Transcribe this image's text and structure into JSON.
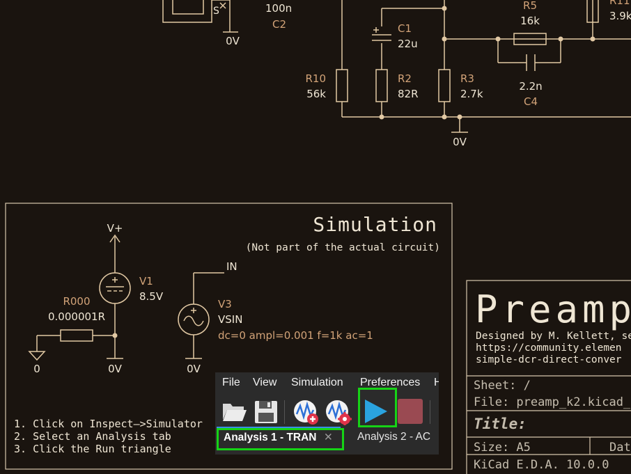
{
  "schematic": {
    "top_parts": {
      "c2": {
        "value": "100n",
        "ref": "C2"
      },
      "c1": {
        "ref": "C1",
        "value": "22u"
      },
      "r5": {
        "ref": "R5",
        "value": "16k"
      },
      "r10": {
        "ref": "R10",
        "value": "56k"
      },
      "r2": {
        "ref": "R2",
        "value": "82R"
      },
      "r3": {
        "ref": "R3",
        "value": "2.7k"
      },
      "c4": {
        "value": "2.2n",
        "ref": "C4"
      },
      "r11": {
        "ref": "R11",
        "value": "3.9k"
      },
      "gnd_labels": [
        "0V",
        "0V"
      ],
      "switch_pin": "S"
    },
    "simulation_box": {
      "title": "Simulation",
      "subtitle": "(Not part of the actual circuit)",
      "v1": {
        "ref": "V1",
        "value": "8.5V",
        "net": "V+"
      },
      "r000": {
        "ref": "R000",
        "value": "0.000001R"
      },
      "v3": {
        "ref": "V3",
        "value": "VSIN",
        "params": "dc=0 ampl=0.001 f=1k ac=1",
        "net": "IN"
      },
      "gnd_labels": [
        "0",
        "0V",
        "0V"
      ],
      "instructions": [
        "1. Click on Inspect—>Simulator",
        "2. Select an Analysis tab",
        "3. Click the Run triangle"
      ]
    },
    "title_block": {
      "big_title": "Preamp",
      "designer": "Designed by M. Kellett, se",
      "url1": "https://community.elemen",
      "url2": "simple-dcr-direct-conver",
      "sheet": "Sheet: /",
      "file": "File: preamp_k2.kicad_",
      "title_label": "Title:",
      "size": "Size: A5",
      "date": "Dat",
      "version": "KiCad E.D.A. 10.0.0"
    }
  },
  "simulator": {
    "menu": [
      "File",
      "View",
      "Simulation",
      "Preferences",
      "H"
    ],
    "toolbar": {
      "open": "folder-open-icon",
      "save": "save-icon",
      "add_signal": "add-signals-icon",
      "sim_settings": "simulation-settings-icon",
      "run": "run-triangle-icon",
      "stop": "stop-icon"
    },
    "tabs": [
      {
        "label": "Analysis 1 - TRAN",
        "close": "✕"
      },
      {
        "label": "Analysis 2 - AC"
      }
    ],
    "colors": {
      "highlight": "#16d316",
      "run": "#2aa3df",
      "stop": "#9a4a52",
      "background": "#1a140f"
    }
  }
}
